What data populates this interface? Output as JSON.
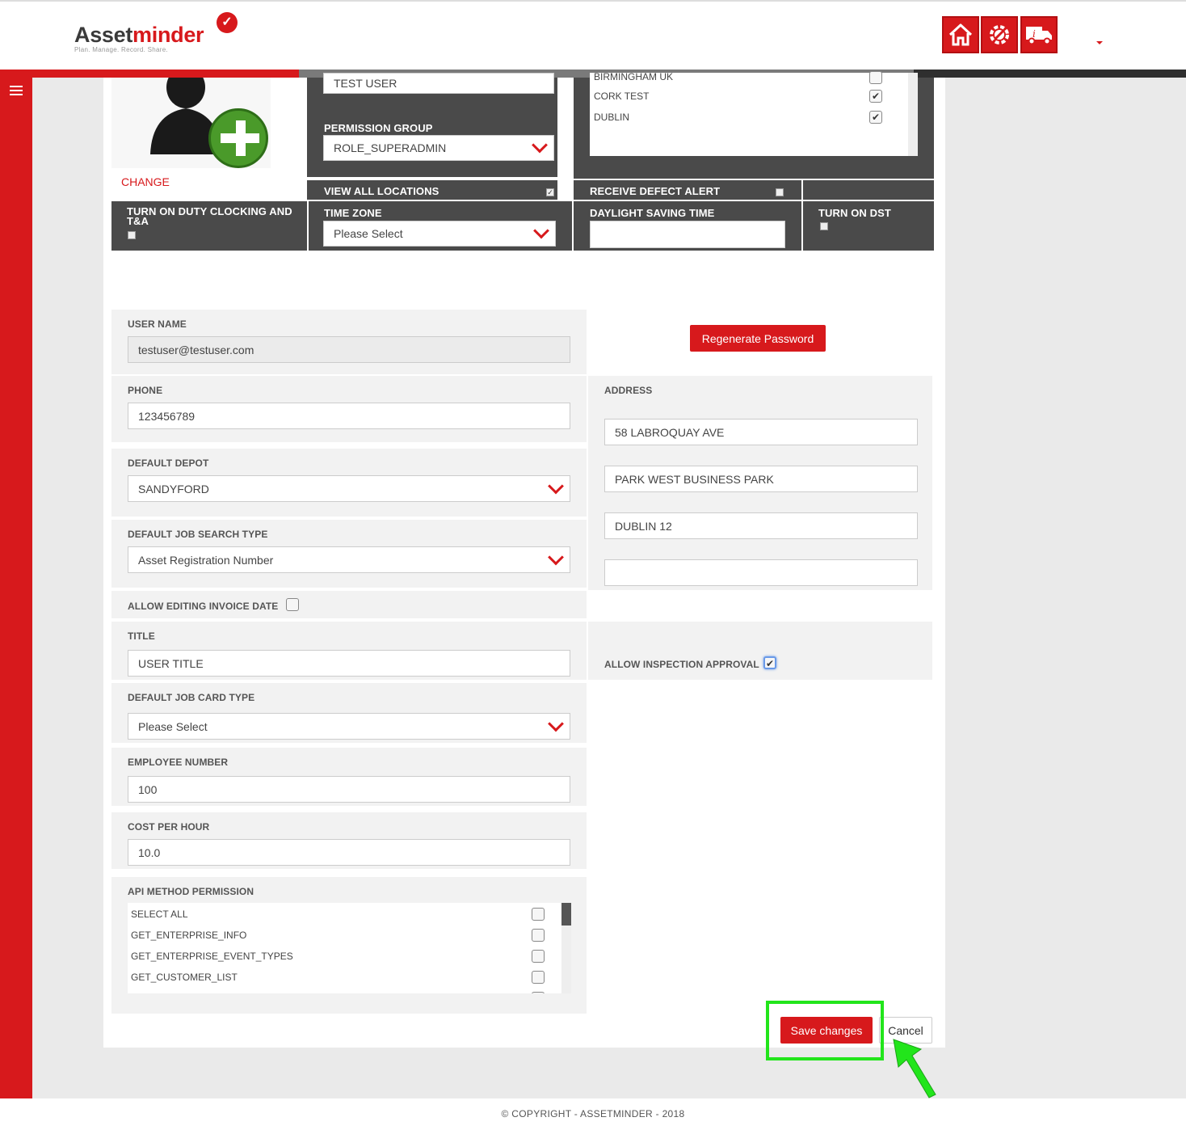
{
  "header": {
    "logo_main": "Asset",
    "logo_accent": "minder",
    "logo_tagline": "Plan. Manage. Record. Share."
  },
  "profile": {
    "change_label": "CHANGE"
  },
  "top_form": {
    "name_value": "TEST USER",
    "permission_group_label": "PERMISSION GROUP",
    "permission_group_value": "ROLE_SUPERADMIN",
    "locations": [
      {
        "name": "BIRMINGHAM UK",
        "checked": false
      },
      {
        "name": "CORK TEST",
        "checked": true
      },
      {
        "name": "DUBLIN",
        "checked": true
      }
    ],
    "view_all_locations_label": "VIEW ALL LOCATIONS",
    "receive_defect_alert_label": "RECEIVE DEFECT ALERT",
    "duty_clocking_label": "TURN ON DUTY CLOCKING AND T&A",
    "time_zone_label": "TIME ZONE",
    "time_zone_value": "Please Select",
    "dst_label": "DAYLIGHT SAVING TIME",
    "dst_value": "",
    "turn_on_dst_label": "TURN ON DST"
  },
  "form": {
    "username_label": "USER NAME",
    "username_value": "testuser@testuser.com",
    "regenerate_label": "Regenerate Password",
    "phone_label": "PHONE",
    "phone_value": "123456789",
    "address_label": "ADDRESS",
    "address_lines": [
      "58 LABROQUAY AVE",
      "PARK WEST BUSINESS PARK",
      "DUBLIN 12",
      ""
    ],
    "default_depot_label": "DEFAULT DEPOT",
    "default_depot_value": "SANDYFORD",
    "job_search_label": "DEFAULT JOB SEARCH TYPE",
    "job_search_value": "Asset Registration Number",
    "allow_invoice_label": "ALLOW EDITING INVOICE DATE",
    "title_label": "TITLE",
    "title_placeholder": "USER TITLE",
    "allow_inspection_label": "ALLOW INSPECTION APPROVAL",
    "job_card_label": "DEFAULT JOB CARD TYPE",
    "job_card_value": "Please Select",
    "employee_label": "EMPLOYEE NUMBER",
    "employee_value": "100",
    "cost_label": "COST PER HOUR",
    "cost_value": "10.0",
    "api_label": "API METHOD PERMISSION",
    "api_items": [
      "SELECT ALL",
      "GET_ENTERPRISE_INFO",
      "GET_ENTERPRISE_EVENT_TYPES",
      "GET_CUSTOMER_LIST"
    ]
  },
  "actions": {
    "save_label": "Save changes",
    "cancel_label": "Cancel"
  },
  "footer": {
    "copyright": "© COPYRIGHT - ASSETMINDER - 2018"
  },
  "colors": {
    "brand_red": "#d7191c",
    "dark_panel": "#4a4a4a",
    "highlight_green": "#22e51b"
  },
  "icons": [
    "home-icon",
    "settings-wrench-icon",
    "truck-info-icon",
    "menu-icon",
    "add-user-icon",
    "chevron-down-icon",
    "pointer-arrow-icon"
  ]
}
